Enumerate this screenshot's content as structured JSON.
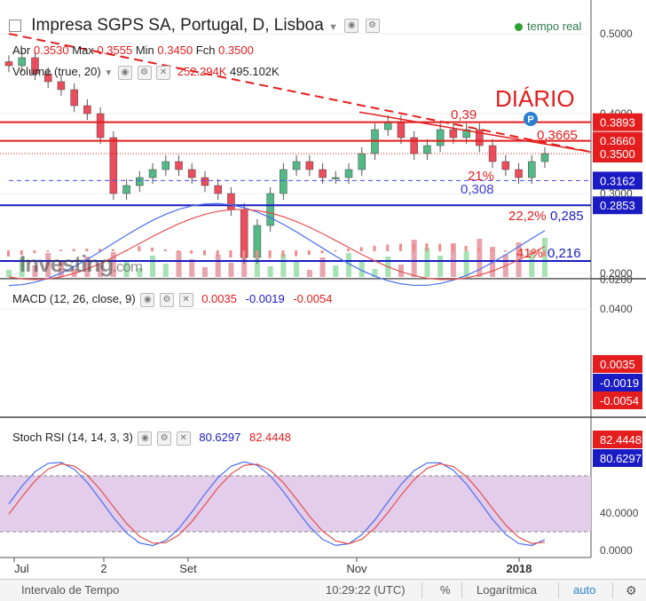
{
  "header": {
    "symbol": "Impresa SGPS SA, Portugal, D, Lisboa",
    "live_label": "tempo real",
    "ohlc": {
      "abr_label": "Abr",
      "abr": "0.3530",
      "max_label": "Max",
      "max": "0.3555",
      "min_label": "Min",
      "min": "0.3450",
      "fch_label": "Fch",
      "fch": "0.3500"
    },
    "volume_label": "Volume (true, 20)",
    "volume_values": [
      "252.294K",
      "495.102K"
    ],
    "watermark": "Investing",
    "watermark_suffix": ".com"
  },
  "annotations": {
    "title": "DIÁRIO",
    "labels": [
      "0,39",
      "0,3665",
      "21%",
      "0,308",
      "22,2%",
      "0,285",
      "41%",
      "0,216"
    ],
    "pin": "P"
  },
  "price_axis": {
    "ticks": [
      "0.5000",
      "0.4000",
      "0.3000",
      "0.2000"
    ],
    "tags": [
      {
        "value": "0.3893",
        "color": "#e41e1e"
      },
      {
        "value": "0.3660",
        "color": "#e41e1e"
      },
      {
        "value": "0.3500",
        "color": "#e41e1e"
      },
      {
        "value": "0.3162",
        "color": "#1b1bc4"
      },
      {
        "value": "0.2853",
        "color": "#1b1bc4"
      }
    ]
  },
  "macd": {
    "label": "MACD (12, 26, close, 9)",
    "values": [
      "0.0035",
      "-0.0019",
      "-0.0054"
    ],
    "ticks": [
      "0.0400",
      "0.0200"
    ],
    "tags": [
      {
        "value": "0.0035",
        "color": "#e41e1e"
      },
      {
        "value": "-0.0019",
        "color": "#1b1bc4"
      },
      {
        "value": "-0.0054",
        "color": "#e41e1e"
      }
    ]
  },
  "stoch": {
    "label": "Stoch RSI (14, 14, 3, 3)",
    "values": [
      "80.6297",
      "82.4448"
    ],
    "ticks": [
      "40.0000",
      "0.0000"
    ],
    "tags": [
      {
        "value": "82.4448",
        "color": "#e41e1e"
      },
      {
        "value": "80.6297",
        "color": "#1b1bc4"
      }
    ]
  },
  "time_axis": [
    "Jul",
    "2",
    "Set",
    "Nov",
    "2018"
  ],
  "bottombar": {
    "interval": "Intervalo de Tempo",
    "time": "10:29:22 (UTC)",
    "percent": "%",
    "log": "Logarítmica",
    "auto": "auto"
  },
  "colors": {
    "up": "#53b987",
    "down": "#eb4d5c",
    "red": "#e41e1e",
    "blue": "#1b1bc4",
    "stoch_band": "#e3cdea"
  },
  "chart_data": {
    "type": "line",
    "title": "Impresa SGPS SA, Portugal, D, Lisboa",
    "xlabel": "",
    "ylabel": "",
    "x_ticks": [
      "Jul",
      "2",
      "Set",
      "Nov",
      "2018"
    ],
    "ylim": [
      0.195,
      0.52
    ],
    "series": [
      {
        "name": "close",
        "values": [
          0.46,
          0.47,
          0.45,
          0.44,
          0.43,
          0.41,
          0.4,
          0.37,
          0.3,
          0.31,
          0.32,
          0.33,
          0.34,
          0.33,
          0.32,
          0.31,
          0.3,
          0.28,
          0.22,
          0.26,
          0.3,
          0.33,
          0.34,
          0.33,
          0.32,
          0.32,
          0.33,
          0.35,
          0.38,
          0.39,
          0.37,
          0.35,
          0.36,
          0.38,
          0.37,
          0.38,
          0.36,
          0.34,
          0.33,
          0.32,
          0.34,
          0.35
        ]
      }
    ],
    "horizontal_levels": [
      0.3893,
      0.366,
      0.35,
      0.3162,
      0.2853,
      0.2155
    ],
    "macd": {
      "macd": 0.0035,
      "signal": -0.0019,
      "histogram": -0.0054
    },
    "stoch_rsi": {
      "k": 80.6297,
      "d": 82.4448
    }
  }
}
